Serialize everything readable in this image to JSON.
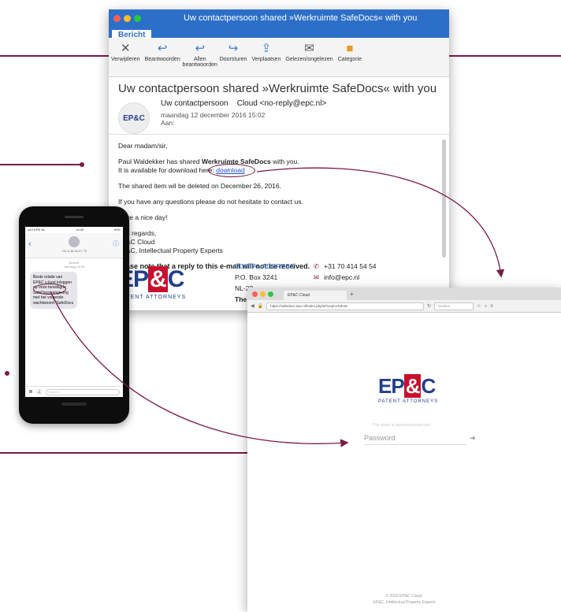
{
  "mail": {
    "window_title": "Uw contactpersoon shared »Werkruimte SafeDocs« with you",
    "ribbon_tab": "Bericht",
    "ribbon": [
      "Verwijderen",
      "Beantwoorden",
      "Allen beantwoorden",
      "Doorsturen",
      "Verplaatsen",
      "Gelezen/ongelezen",
      "Categorie"
    ],
    "subject": "Uw contactpersoon shared »Werkruimte SafeDocs« with you",
    "avatar_text": "EP&C",
    "from_name": "Uw contactpersoon",
    "from_addr": "Cloud <no-reply@epc.nl>",
    "date": "maandag 12 december 2016 15:02",
    "to_label": "Aan:",
    "greeting": "Dear madam/sir,",
    "shared_line_pre": "Paul Waldekker has shared ",
    "shared_item": "Werkruimte SafeDocs",
    "shared_line_post": " with you.",
    "available_text": "It is available for download here: ",
    "download_link": "download",
    "deleted_line": "The shared item wil be deleted on December 26, 2016.",
    "questions_line": "If you have any questions please do not hesitate to contact us.",
    "nice_day": "ve a nice day!",
    "regards": "d regards,",
    "sig1": "&C Cloud",
    "sig2": "&C, Intellectual Property Experts",
    "note": "ase note that a reply to this e-mail will not be received.",
    "footer_logo_left": "EP",
    "footer_logo_mid": "&",
    "footer_logo_right": "C",
    "footer_sub": "PATENT ATTORNEYS",
    "postal_heading": "POSTAL ADDRESS",
    "po_box": "P.O. Box 3241",
    "postal_line2": "NL-22",
    "postal_line3": "The N",
    "phone": "+31 70 414 54 54",
    "email": "info@epc.nl"
  },
  "phone": {
    "status_left": "••••• KPN NL",
    "status_time": "16:09",
    "status_right": "63%",
    "contact_number": "+31 6 48 04 67 70",
    "message_time": "Bericht\nVandaag 16:09",
    "message": "Beste relatie van EP&C u kunt inloggen op onze beveiligde SafeDocs omgeving met het volgende wachtwoord: SafeDocs",
    "input_placeholder": "Bericht"
  },
  "browser": {
    "tab_title": "EP&C Cloud",
    "url": "https://safedocs.epc.nl/index.php/s/GnqmVXZHw",
    "search_placeholder": "Zoeken",
    "logo_left": "EP",
    "logo_mid": "&",
    "logo_right": "C",
    "logo_sub": "PATENT ATTORNEYS",
    "hint": "This share is password-protected",
    "password_placeholder": "Password",
    "copyright": "© 2015 EP&C Cloud.",
    "tagline": "EP&C, Intellectual Property Experts"
  },
  "colors": {
    "accent": "#7a1b48",
    "mail_blue": "#2c6fc8",
    "brand_blue": "#233f8a",
    "brand_red": "#c8102e"
  }
}
